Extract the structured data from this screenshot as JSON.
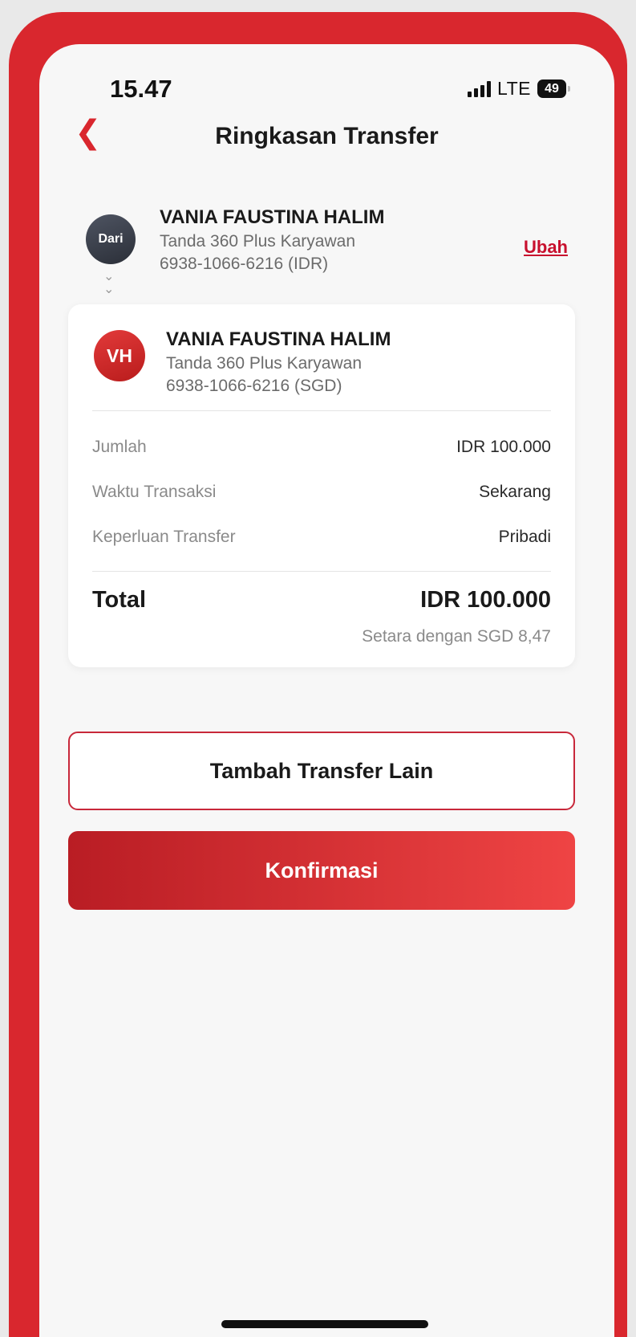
{
  "status_bar": {
    "time": "15.47",
    "network": "LTE",
    "battery": "49"
  },
  "header": {
    "title": "Ringkasan Transfer"
  },
  "from_account": {
    "avatar_label": "Dari",
    "name": "VANIA FAUSTINA HALIM",
    "product": "Tanda 360 Plus Karyawan",
    "account": "6938-1066-6216 (IDR)",
    "change_label": "Ubah"
  },
  "to_account": {
    "initials": "VH",
    "name": "VANIA FAUSTINA HALIM",
    "product": "Tanda 360 Plus Karyawan",
    "account": "6938-1066-6216 (SGD)"
  },
  "details": [
    {
      "label": "Jumlah",
      "value": "IDR 100.000"
    },
    {
      "label": "Waktu Transaksi",
      "value": "Sekarang"
    },
    {
      "label": "Keperluan Transfer",
      "value": "Pribadi"
    }
  ],
  "total": {
    "label": "Total",
    "value": "IDR 100.000",
    "equivalent": "Setara dengan SGD 8,47"
  },
  "buttons": {
    "add_transfer": "Tambah Transfer Lain",
    "confirm": "Konfirmasi"
  },
  "colors": {
    "accent": "#d9272e",
    "link": "#c8102e",
    "background": "#f7f7f7"
  }
}
